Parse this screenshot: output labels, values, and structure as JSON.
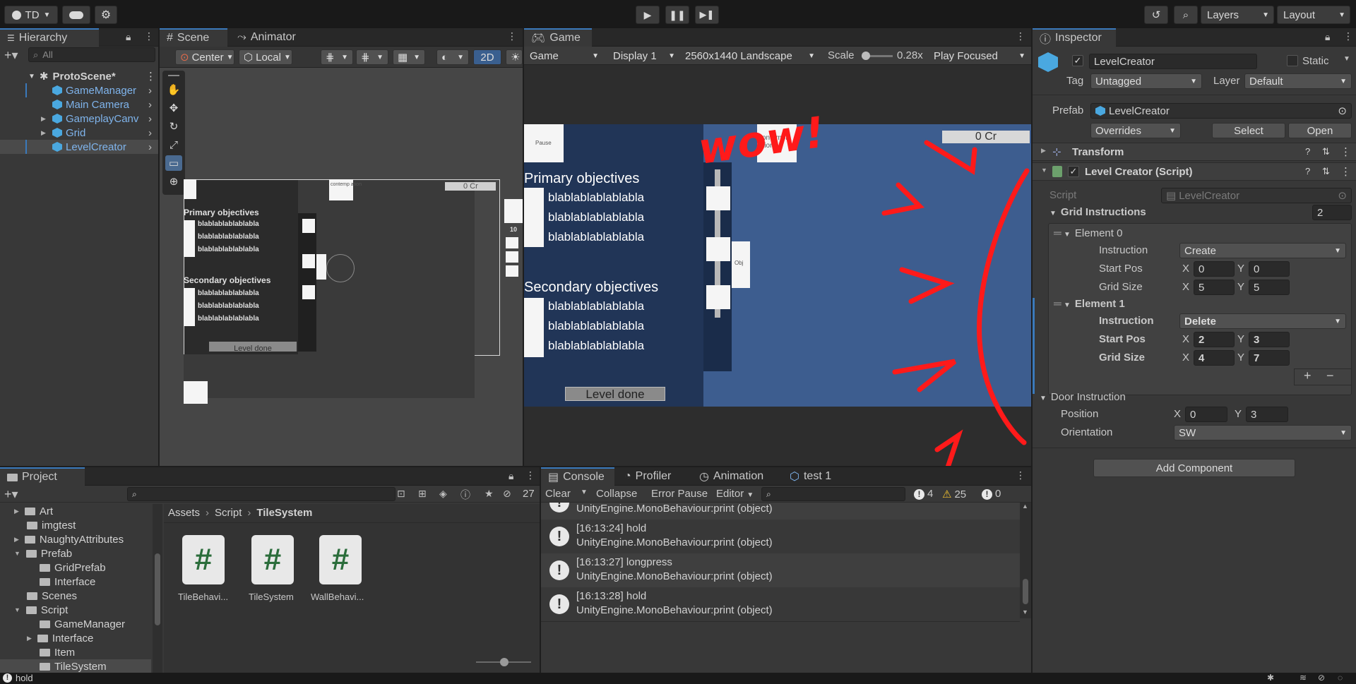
{
  "toolbar": {
    "account_label": "TD",
    "layers_label": "Layers",
    "layout_label": "Layout"
  },
  "hierarchy": {
    "tab": "Hierarchy",
    "search_placeholder": "All",
    "scene_name": "ProtoScene*",
    "items": [
      {
        "label": "GameManager"
      },
      {
        "label": "Main Camera"
      },
      {
        "label": "GameplayCanv"
      },
      {
        "label": "Grid"
      },
      {
        "label": "LevelCreator"
      }
    ]
  },
  "scene": {
    "tab": "Scene",
    "animator_tab": "Animator",
    "pivot_label": "Center",
    "space_label": "Local",
    "mode_2d": "2D",
    "texts": {
      "counter": "0 Cr",
      "primary": "Primary objectives",
      "secondary": "Secondary objectives",
      "bla": "blablablablablabla",
      "level_done": "Level done",
      "contemplate": "contemp ation",
      "ten": "10"
    }
  },
  "game": {
    "tab": "Game",
    "mode": "Game",
    "display": "Display 1",
    "resolution": "2560x1440 Landscape",
    "scale_label": "Scale",
    "scale_value": "0.28x",
    "play_mode": "Play Focused",
    "pause_label": "Pause",
    "counter": "0 Cr",
    "primary": "Primary objectives",
    "secondary": "Secondary objectives",
    "bla": "blablablablablabla",
    "level_done": "Level done",
    "contemplate": "contempl ation",
    "obj_label": "Obj",
    "annotation": "wow!"
  },
  "inspector": {
    "tab": "Inspector",
    "object_name": "LevelCreator",
    "static_label": "Static",
    "tag_label": "Tag",
    "tag_value": "Untagged",
    "layer_label": "Layer",
    "layer_value": "Default",
    "prefab_label": "Prefab",
    "prefab_value": "LevelCreator",
    "overrides": "Overrides",
    "select": "Select",
    "open": "Open",
    "transform": "Transform",
    "component": "Level Creator (Script)",
    "script_label": "Script",
    "script_value": "LevelCreator",
    "grid_instructions": "Grid Instructions",
    "grid_count": "2",
    "elements": [
      {
        "title": "Element 0",
        "instruction_label": "Instruction",
        "instruction": "Create",
        "start_label": "Start Pos",
        "sx": "0",
        "sy": "0",
        "size_label": "Grid Size",
        "gx": "5",
        "gy": "5"
      },
      {
        "title": "Element 1",
        "instruction_label": "Instruction",
        "instruction": "Delete",
        "start_label": "Start Pos",
        "sx": "2",
        "sy": "3",
        "size_label": "Grid Size",
        "gx": "4",
        "gy": "7"
      }
    ],
    "x_label": "X",
    "y_label": "Y",
    "door_instruction": "Door Instruction",
    "position_label": "Position",
    "door_x": "0",
    "door_y": "3",
    "orientation_label": "Orientation",
    "orientation_value": "SW",
    "add_component": "Add Component",
    "plus": "+",
    "minus": "−"
  },
  "project": {
    "tab": "Project",
    "hidden_count": "27",
    "breadcrumb": [
      "Assets",
      "Script",
      "TileSystem"
    ],
    "tree": [
      {
        "label": "Art"
      },
      {
        "label": "imgtest"
      },
      {
        "label": "NaughtyAttributes"
      },
      {
        "label": "Prefab"
      },
      {
        "label": "GridPrefab"
      },
      {
        "label": "Interface"
      },
      {
        "label": "Scenes"
      },
      {
        "label": "Script"
      },
      {
        "label": "GameManager"
      },
      {
        "label": "Interface"
      },
      {
        "label": "Item"
      },
      {
        "label": "TileSystem"
      }
    ],
    "files": [
      {
        "label": "TileBehavi..."
      },
      {
        "label": "TileSystem"
      },
      {
        "label": "WallBehavi..."
      }
    ]
  },
  "console": {
    "tab": "Console",
    "profiler_tab": "Profiler",
    "animation_tab": "Animation",
    "test_tab": "test 1",
    "clear": "Clear",
    "collapse": "Collapse",
    "error_pause": "Error Pause",
    "editor": "Editor",
    "info_count": "4",
    "warn_count": "25",
    "error_count": "0",
    "partial_line": "UnityEngine.MonoBehaviour:print (object)",
    "logs": [
      {
        "time_msg": "[16:13:24] hold",
        "detail": "UnityEngine.MonoBehaviour:print (object)"
      },
      {
        "time_msg": "[16:13:27] longpress",
        "detail": "UnityEngine.MonoBehaviour:print (object)"
      },
      {
        "time_msg": "[16:13:28] hold",
        "detail": "UnityEngine.MonoBehaviour:print (object)"
      }
    ]
  },
  "status_bar": {
    "message": "hold"
  }
}
